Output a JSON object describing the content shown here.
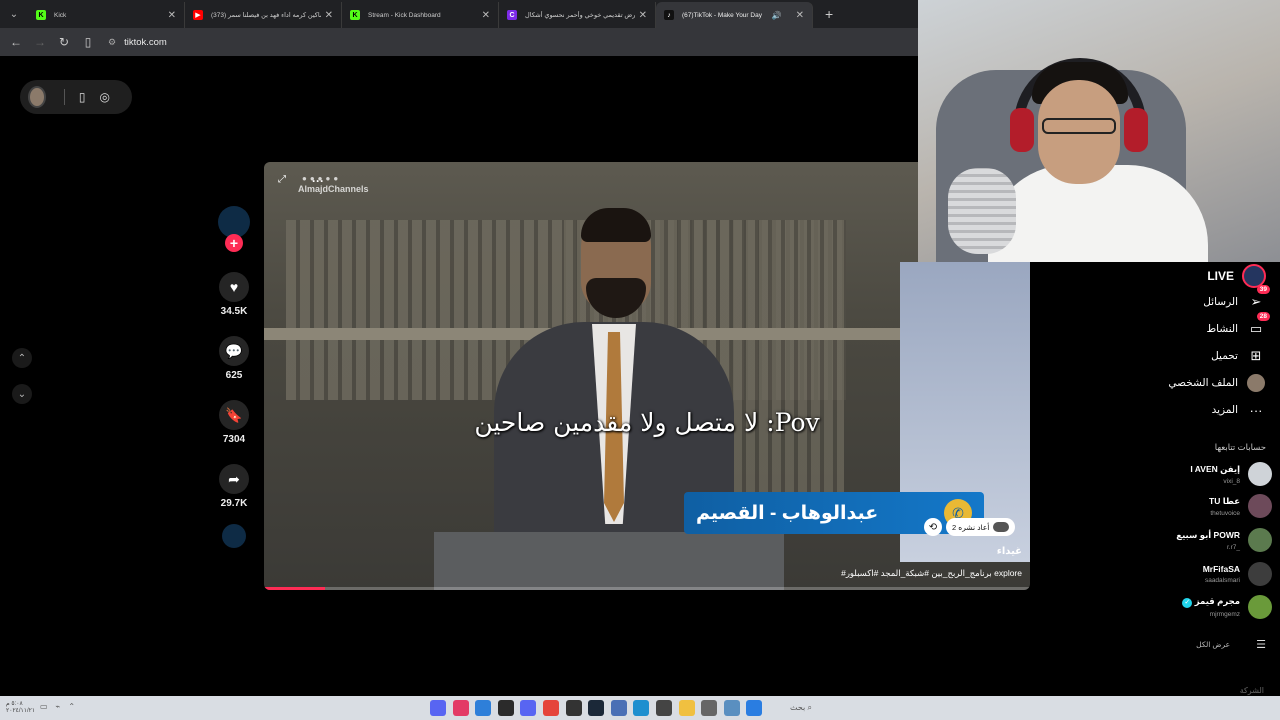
{
  "browser": {
    "tabs": [
      {
        "title": "Kick",
        "favicon_color": "#53fc18",
        "favicon_glyph": "K",
        "active": false
      },
      {
        "title": "(373) هكر ماكين كرمه اداء فهد بن فيصلنا سمر",
        "favicon_color": "#ff0000",
        "favicon_glyph": "▶",
        "active": false
      },
      {
        "title": "Stream - Kick Dashboard",
        "favicon_color": "#53fc18",
        "favicon_glyph": "K",
        "active": false
      },
      {
        "title": "عرض تقديمي خوخي وأحمر نحسوي أشكال",
        "favicon_color": "#7d2ae8",
        "favicon_glyph": "C",
        "active": false
      },
      {
        "title": "(67)TikTok - Make Your Day",
        "favicon_color": "#111111",
        "favicon_glyph": "♪",
        "active": true
      }
    ],
    "url": "tiktok.com"
  },
  "actions": {
    "likes": "34.5K",
    "comments": "625",
    "saves": "7304",
    "shares": "29.7K"
  },
  "video": {
    "watermark": "AlmajdChannels",
    "caption_overlay": "لا متصل ولا مقدمين صاحين :Pov",
    "lower_third": "عبدالوهاب - القصيم",
    "repost_text": "2 أعاد نشره",
    "author": "غيداء",
    "description": "#برنامج_الربح_بين #شبكة_المجد #اكسبلور explore",
    "progress": 0.08
  },
  "sidebar": {
    "live": "LIVE",
    "messages": {
      "label": "الرسائل",
      "badge": "39"
    },
    "activity": {
      "label": "النشاط",
      "badge": "28"
    },
    "upload": "تحميل",
    "profile": "الملف الشخصي",
    "more": "المزيد",
    "following_title": "حسابات تتابعها",
    "accounts": [
      {
        "name": "I AVEN إيفن",
        "handle": "vixi_8",
        "color": "#cfd3d8"
      },
      {
        "name": "TU عطا",
        "handle": "thetuvoice",
        "color": "#6d4a5a"
      },
      {
        "name": "أبو سبيع POWR",
        "handle": "r.r7_",
        "color": "#5b7a4e"
      },
      {
        "name": "MrFifaSA",
        "handle": "saadalsmari",
        "color": "#3d3d3d"
      },
      {
        "name": "مجرم قيمز",
        "handle": "mjrmgemz",
        "color": "#6a9a3a",
        "verified": true
      }
    ],
    "see_all": "عرض الكل",
    "footer": "الشركة"
  },
  "taskbar": {
    "search": "بحث",
    "time": "٥:٠٨ م",
    "date": "٢٠٢٤/١١/٢١"
  }
}
